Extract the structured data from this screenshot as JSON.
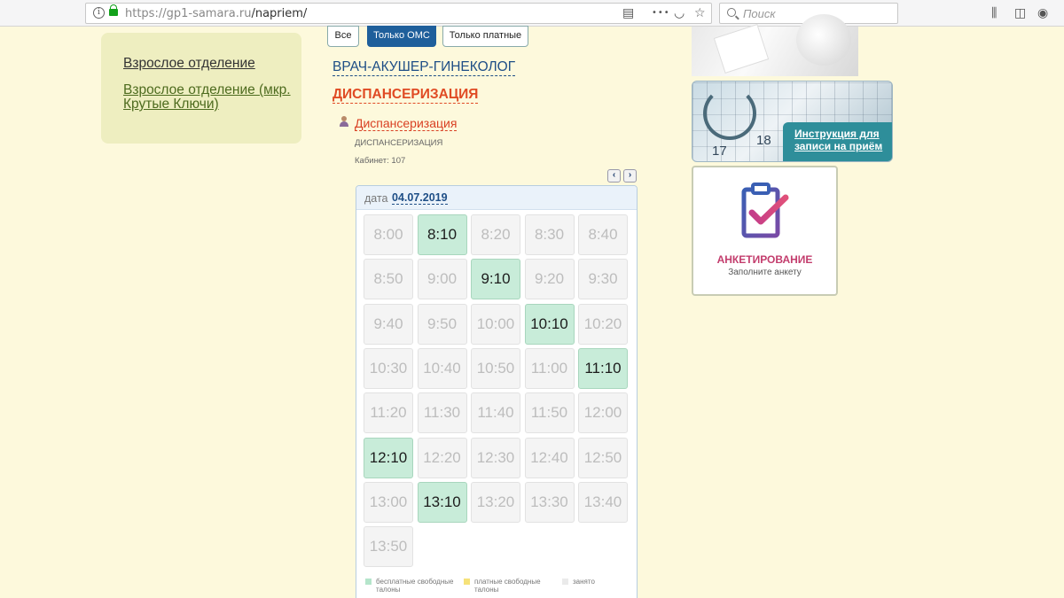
{
  "browser": {
    "url_host": "https://gp1-samara.ru",
    "url_path": "/napriem/",
    "search_placeholder": "Поиск",
    "menu_glyph": "•••"
  },
  "sidebar": {
    "items": [
      {
        "label": "Взрослое отделение"
      },
      {
        "label": "Взрослое отделение (мкр. Крутые Ключи)"
      }
    ]
  },
  "filters": {
    "all": "Все",
    "oms_only": "Только ОМС",
    "paid_only": "Только платные"
  },
  "doctor": "ВРАЧ-АКУШЕР-ГИНЕКОЛОГ",
  "section_title": "ДИСПАНСЕРИЗАЦИЯ",
  "service": {
    "name": "Диспансеризация",
    "subtitle": "ДИСПАНСЕРИЗАЦИЯ",
    "cabinet": "Кабинет: 107"
  },
  "navigation": {
    "prev": "‹",
    "next": "›"
  },
  "schedule": {
    "date_label": "дата",
    "date": "04.07.2019",
    "slots": [
      {
        "time": "8:00",
        "status": "busy"
      },
      {
        "time": "8:10",
        "status": "free"
      },
      {
        "time": "8:20",
        "status": "busy"
      },
      {
        "time": "8:30",
        "status": "busy"
      },
      {
        "time": "8:40",
        "status": "busy"
      },
      {
        "time": "8:50",
        "status": "busy"
      },
      {
        "time": "9:00",
        "status": "busy"
      },
      {
        "time": "9:10",
        "status": "free"
      },
      {
        "time": "9:20",
        "status": "busy"
      },
      {
        "time": "9:30",
        "status": "busy"
      },
      {
        "time": "9:40",
        "status": "busy"
      },
      {
        "time": "9:50",
        "status": "busy"
      },
      {
        "time": "10:00",
        "status": "busy"
      },
      {
        "time": "10:10",
        "status": "free"
      },
      {
        "time": "10:20",
        "status": "busy"
      },
      {
        "time": "10:30",
        "status": "busy"
      },
      {
        "time": "10:40",
        "status": "busy"
      },
      {
        "time": "10:50",
        "status": "busy"
      },
      {
        "time": "11:00",
        "status": "busy"
      },
      {
        "time": "11:10",
        "status": "free"
      },
      {
        "time": "11:20",
        "status": "busy"
      },
      {
        "time": "11:30",
        "status": "busy"
      },
      {
        "time": "11:40",
        "status": "busy"
      },
      {
        "time": "11:50",
        "status": "busy"
      },
      {
        "time": "12:00",
        "status": "busy"
      },
      {
        "time": "12:10",
        "status": "free"
      },
      {
        "time": "12:20",
        "status": "busy"
      },
      {
        "time": "12:30",
        "status": "busy"
      },
      {
        "time": "12:40",
        "status": "busy"
      },
      {
        "time": "12:50",
        "status": "busy"
      },
      {
        "time": "13:00",
        "status": "busy"
      },
      {
        "time": "13:10",
        "status": "free"
      },
      {
        "time": "13:20",
        "status": "busy"
      },
      {
        "time": "13:30",
        "status": "busy"
      },
      {
        "time": "13:40",
        "status": "busy"
      },
      {
        "time": "13:50",
        "status": "busy"
      }
    ],
    "legend": {
      "free": "бесплатные свободные талоны",
      "paid": "платные свободные талоны",
      "busy": "занято"
    }
  },
  "banners": {
    "instruction": "Инструкция для записи на приём",
    "instruction_dates": [
      "17",
      "18"
    ],
    "survey_title": "АНКЕТИРОВАНИЕ",
    "survey_subtitle": "Заполните анкету"
  },
  "colors": {
    "accent_blue": "#1f5f9b",
    "accent_red": "#e04b24",
    "free_slot": "#c8ecd9",
    "survey_pink": "#c33d6d",
    "page_bg": "#fdf9dc"
  }
}
